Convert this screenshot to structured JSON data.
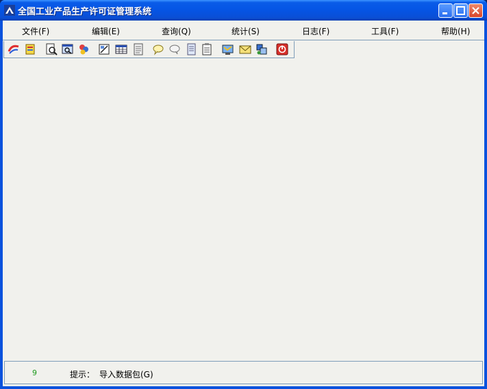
{
  "window": {
    "title": "全国工业产品生产许可证管理系统",
    "controls": [
      "minimize-icon",
      "maximize-icon",
      "close-icon"
    ]
  },
  "menubar": {
    "items": [
      {
        "label": "文件(F)"
      },
      {
        "label": "编辑(E)"
      },
      {
        "label": "查询(Q)"
      },
      {
        "label": "统计(S)"
      },
      {
        "label": "日志(F)"
      },
      {
        "label": "工具(F)"
      },
      {
        "label": "帮助(H)"
      }
    ]
  },
  "toolbar": {
    "icons": [
      "import-icon",
      "export-icon",
      "search-document-icon",
      "find-window-icon",
      "statistics-icon",
      "edit-form-icon",
      "table-grid-icon",
      "report-icon",
      "comment-icon",
      "message-icon",
      "page-icon",
      "notes-icon",
      "database-icon",
      "mail-icon",
      "settings-icon",
      "power-icon"
    ]
  },
  "statusbar": {
    "count": "9",
    "hint_label": "提示：",
    "hint_text": "导入数据包(G)"
  },
  "colors": {
    "titlebar": "#0554e4",
    "client": "#f1f1ed",
    "border": "#7f9db9",
    "count_text": "#1e9a1e"
  }
}
